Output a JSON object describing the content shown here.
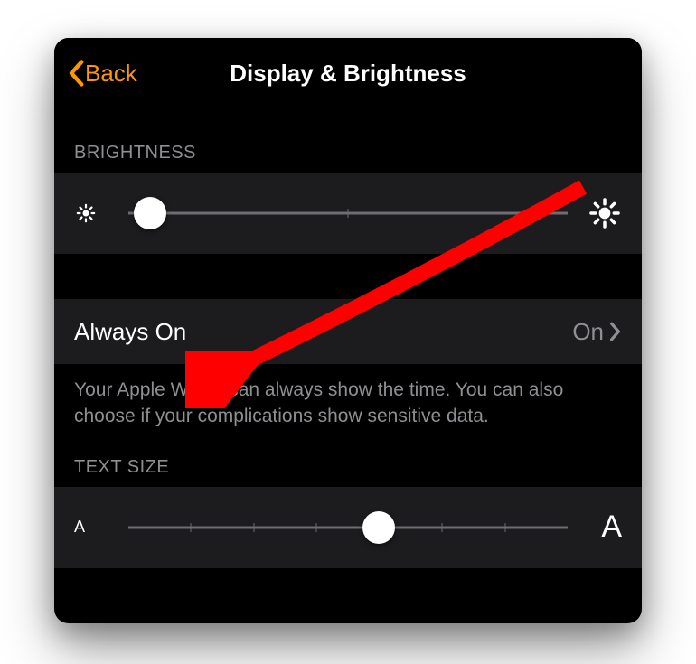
{
  "nav": {
    "back_label": "Back",
    "title": "Display & Brightness"
  },
  "brightness": {
    "header": "BRIGHTNESS",
    "value_percent": 5,
    "min_icon": "sun-small-icon",
    "max_icon": "sun-large-icon"
  },
  "always_on": {
    "label": "Always On",
    "value": "On",
    "footer": "Your Apple Watch can always show the time. You can also choose if your complications show sensitive data."
  },
  "text_size": {
    "header": "TEXT SIZE",
    "value_percent": 57,
    "min_glyph": "A",
    "max_glyph": "A"
  },
  "annotation": {
    "arrow_color": "#ff0000"
  }
}
